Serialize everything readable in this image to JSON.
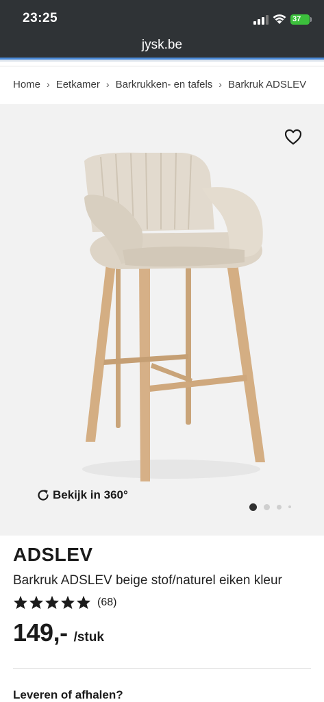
{
  "status_bar": {
    "time": "23:25",
    "battery": "37"
  },
  "browser": {
    "url": "jysk.be"
  },
  "breadcrumb": [
    {
      "label": "Home"
    },
    {
      "label": "Eetkamer"
    },
    {
      "label": "Barkrukken- en tafels"
    },
    {
      "label": "Barkruk ADSLEV"
    }
  ],
  "gallery": {
    "view360_label": "Bekijk in 360°",
    "current_slide": 1,
    "slide_count": 4
  },
  "product": {
    "name": "ADSLEV",
    "description": "Barkruk ADSLEV beige stof/naturel eiken kleur",
    "rating": 5,
    "review_count": "(68)",
    "price": "149,-",
    "price_unit": "/stuk"
  },
  "delivery": {
    "title": "Leveren of afhalen?"
  },
  "colors": {
    "status_bar_bg": "#2f3336",
    "battery": "#3cc03c",
    "progress": "#4a8ad8",
    "gallery_bg": "#f2f2f2"
  },
  "icons": [
    "signal-icon",
    "wifi-icon",
    "battery-icon",
    "heart-icon",
    "rotate-360-icon",
    "star-icon"
  ]
}
